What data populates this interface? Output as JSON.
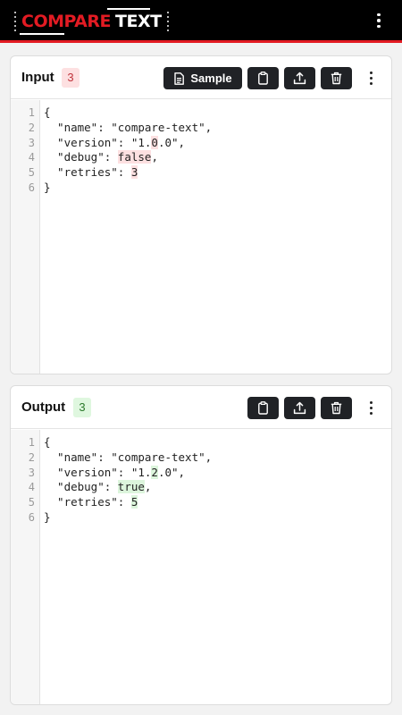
{
  "header": {
    "logo_word_1": "COMPARE",
    "logo_word_2": "TEXT",
    "menu_icon": "vertical-dots-icon"
  },
  "colors": {
    "brand_red": "#e31b23",
    "header_bg": "#000000",
    "button_bg": "#202226",
    "removed_highlight": "#fde0e1",
    "added_highlight": "#dcf5dc"
  },
  "input_panel": {
    "title": "Input",
    "diff_count": "3",
    "sample_label": "Sample",
    "tools": [
      "clipboard-icon",
      "upload-icon",
      "trash-icon"
    ],
    "line_numbers": [
      "1",
      "2",
      "3",
      "4",
      "5",
      "6"
    ],
    "lines": [
      [
        {
          "t": "{"
        }
      ],
      [
        {
          "t": "  \"name\": \"compare-text\","
        }
      ],
      [
        {
          "t": "  \"version\": \"1."
        },
        {
          "t": "0",
          "hl": "del"
        },
        {
          "t": ".0\","
        }
      ],
      [
        {
          "t": "  \"debug\": "
        },
        {
          "t": "false",
          "hl": "del"
        },
        {
          "t": ","
        }
      ],
      [
        {
          "t": "  \"retries\": "
        },
        {
          "t": "3",
          "hl": "del"
        }
      ],
      [
        {
          "t": "}"
        }
      ]
    ]
  },
  "output_panel": {
    "title": "Output",
    "diff_count": "3",
    "tools": [
      "clipboard-icon",
      "upload-icon",
      "trash-icon"
    ],
    "line_numbers": [
      "1",
      "2",
      "3",
      "4",
      "5",
      "6"
    ],
    "lines": [
      [
        {
          "t": "{"
        }
      ],
      [
        {
          "t": "  \"name\": \"compare-text\","
        }
      ],
      [
        {
          "t": "  \"version\": \"1."
        },
        {
          "t": "2",
          "hl": "add"
        },
        {
          "t": ".0\","
        }
      ],
      [
        {
          "t": "  \"debug\": "
        },
        {
          "t": "true",
          "hl": "add"
        },
        {
          "t": ","
        }
      ],
      [
        {
          "t": "  \"retries\": "
        },
        {
          "t": "5",
          "hl": "add"
        }
      ],
      [
        {
          "t": "}"
        }
      ]
    ]
  }
}
